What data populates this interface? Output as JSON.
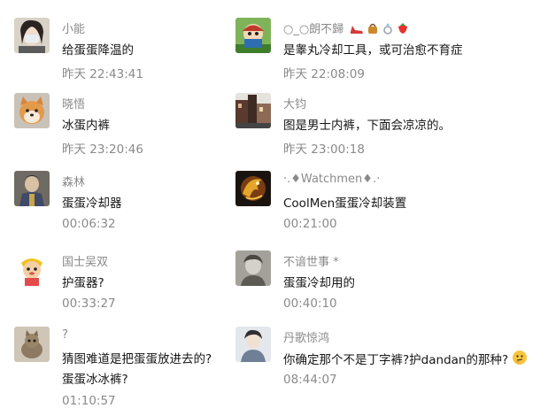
{
  "comments": [
    {
      "name": "小能",
      "text": "给蛋蛋降温的",
      "time": "昨天 22:43:41",
      "avatar_icon": "person-mask-avatar"
    },
    {
      "name": "○_○朗不歸",
      "text": "是睾丸冷却工具，或可治愈不育症",
      "time": "昨天 22:08:09",
      "avatar_icon": "cartoon-character-avatar",
      "badges": [
        "high-heel-shoe-icon",
        "handbag-icon",
        "ring-icon",
        "strawberry-icon"
      ]
    },
    {
      "name": "晓悟",
      "text": "冰蛋内裤",
      "time": "昨天 23:20:46",
      "avatar_icon": "shiba-dog-avatar"
    },
    {
      "name": "大钧",
      "text": "图是男士内裤，下面会凉凉的。",
      "time": "昨天 23:00:18",
      "avatar_icon": "street-scene-avatar"
    },
    {
      "name": "森林",
      "text": "蛋蛋冷却器",
      "time": "00:06:32",
      "avatar_icon": "historical-portrait-avatar"
    },
    {
      "name": "·.♦Watchmen♦.·",
      "text": "CoolMen蛋蛋冷却装置",
      "time": "00:21:00",
      "avatar_icon": "golden-dragon-avatar"
    },
    {
      "name": "国士吴双",
      "text": "护蛋器?",
      "time": "00:33:27",
      "avatar_icon": "cartoon-monkey-avatar"
    },
    {
      "name": "不谙世事 *",
      "text": "蛋蛋冷却用的",
      "time": "00:40:10",
      "avatar_icon": "grayscale-portrait-avatar"
    },
    {
      "name": "?",
      "text": "猜图难道是把蛋蛋放进去的?",
      "text2": "蛋蛋冰冰裤?",
      "time": "01:10:57",
      "avatar_icon": "cat-photo-avatar"
    },
    {
      "name": "丹歌惊鸿",
      "text": "你确定那个不是丁字裤?护dandan的那种?",
      "time": "08:44:07",
      "avatar_icon": "painted-portrait-avatar",
      "trailing_icon": "thinking-face-emoji-icon"
    }
  ]
}
